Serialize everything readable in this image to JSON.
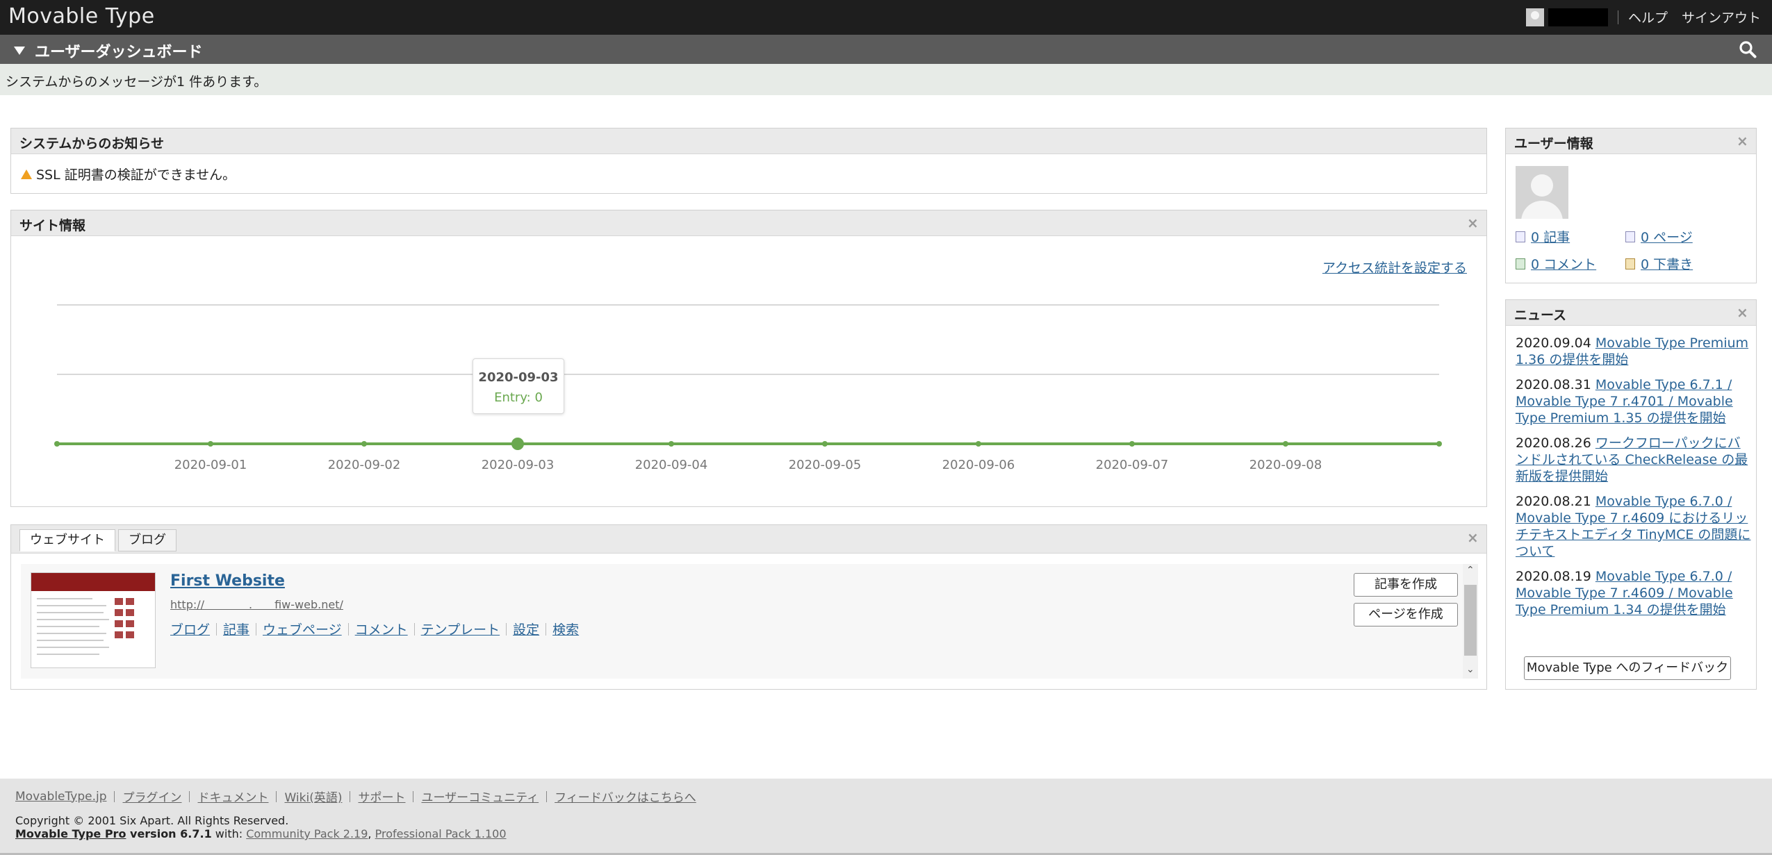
{
  "header": {
    "brand": "Movable Type",
    "help": "ヘルプ",
    "signout": "サインアウト"
  },
  "dashboard": {
    "title": "ユーザーダッシュボード",
    "message": "システムからのメッセージが1 件あります。"
  },
  "system_notice": {
    "title": "システムからのお知らせ",
    "text": "SSL 証明書の検証ができません。"
  },
  "site_info": {
    "title": "サイト情報",
    "access_link": "アクセス統計を設定する",
    "tooltip_date": "2020-09-03",
    "tooltip_value": "Entry: 0"
  },
  "chart_data": {
    "type": "line",
    "x": [
      "",
      "2020-09-01",
      "2020-09-02",
      "2020-09-03",
      "2020-09-04",
      "2020-09-05",
      "2020-09-06",
      "2020-09-07",
      "2020-09-08",
      ""
    ],
    "series": [
      {
        "values": [
          0,
          0,
          0,
          0,
          0,
          0,
          0,
          0,
          0,
          0
        ]
      }
    ],
    "grid": true,
    "highlight_index": 3,
    "line_color": "#6aa84f"
  },
  "blogs": {
    "tabs": [
      "ウェブサイト",
      "ブログ"
    ],
    "site_title": "First Website",
    "site_url": "http://　　　　.　　fiw-web.net/",
    "links": [
      "ブログ",
      "記事",
      "ウェブページ",
      "コメント",
      "テンプレート",
      "設定",
      "検索"
    ],
    "create_entry": "記事を作成",
    "create_page": "ページを作成"
  },
  "user_info": {
    "title": "ユーザー情報",
    "entries": "0 記事",
    "pages": "0 ページ",
    "comments": "0 コメント",
    "drafts": "0 下書き"
  },
  "news": {
    "title": "ニュース",
    "items": [
      {
        "date": "2020.09.04",
        "text": "Movable Type Premium 1.36 の提供を開始"
      },
      {
        "date": "2020.08.31",
        "text": "Movable Type 6.7.1 / Movable Type 7 r.4701 / Movable Type Premium 1.35 の提供を開始"
      },
      {
        "date": "2020.08.26",
        "text": "ワークフローパックにバンドルされている CheckRelease の最新版を提供開始"
      },
      {
        "date": "2020.08.21",
        "text": "Movable Type 6.7.0 / Movable Type 7 r.4609 におけるリッチテキストエディタ TinyMCE の問題について"
      },
      {
        "date": "2020.08.19",
        "text": "Movable Type 6.7.0 / Movable Type 7 r.4609 / Movable Type Premium 1.34 の提供を開始"
      }
    ],
    "feedback_button": "Movable Type へのフィードバック"
  },
  "footer": {
    "links": [
      "MovableType.jp",
      "プラグイン",
      "ドキュメント",
      "Wiki(英語)",
      "サポート",
      "ユーザーコミュニティ",
      "フィードバックはこちらへ"
    ],
    "copyright": "Copyright © 2001 Six Apart. All Rights Reserved.",
    "product": "Movable Type Pro",
    "version": " version 6.7.1",
    "with": " with: ",
    "pack1": "Community Pack 2.19",
    "comma": ", ",
    "pack2": "Professional Pack 1.100"
  }
}
